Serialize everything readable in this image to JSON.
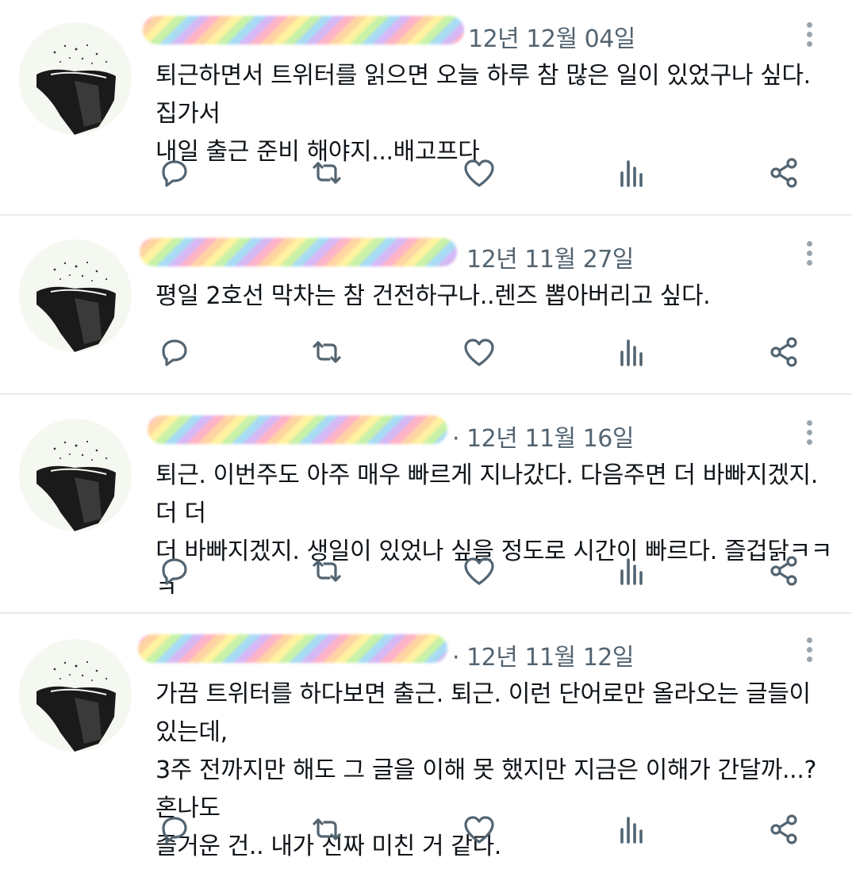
{
  "tweets": [
    {
      "date": "12년 12월 04일",
      "text": "퇴근하면서 트위터를 읽으면 오늘 하루 참 많은 일이 있었구나 싶다. 집가서\n내일 출근 준비 해야지...배고프다",
      "actions": {
        "reply": "reply-icon",
        "retweet": "retweet-icon",
        "like": "heart-icon",
        "views": "views-icon",
        "share": "share-icon"
      }
    },
    {
      "date": "12년 11월 27일",
      "text": "평일 2호선 막차는 참 건전하구나..렌즈 뽑아버리고 싶다.",
      "actions": {
        "reply": "reply-icon",
        "retweet": "retweet-icon",
        "like": "heart-icon",
        "views": "views-icon",
        "share": "share-icon"
      }
    },
    {
      "date": "· 12년 11월 16일",
      "text": "퇴근. 이번주도 아주 매우 빠르게 지나갔다. 다음주면 더 바빠지겠지. 더 더\n더 바빠지겠지. 생일이 있었나 싶을 정도로 시간이 빠르다. 즐겁닭ㅋㅋㅋ",
      "actions": {
        "reply": "reply-icon",
        "retweet": "retweet-icon",
        "like": "heart-icon",
        "views": "views-icon",
        "share": "share-icon"
      }
    },
    {
      "date": "· 12년 11월 12일",
      "text": "가끔 트위터를 하다보면 출근. 퇴근. 이런 단어로만 올라오는 글들이 있는데,\n3주 전까지만 해도 그 글을 이해 못 했지만 지금은 이해가 간달까...? 혼나도\n즐거운 건.. 내가 진짜 미친 거 같다.",
      "actions": {
        "reply": "reply-icon",
        "retweet": "retweet-icon",
        "like": "heart-icon",
        "views": "views-icon",
        "share": "share-icon"
      }
    }
  ],
  "colors": {
    "text": "#0f1419",
    "meta": "#536471",
    "icon": "#536471",
    "divider": "#e8ecef"
  }
}
